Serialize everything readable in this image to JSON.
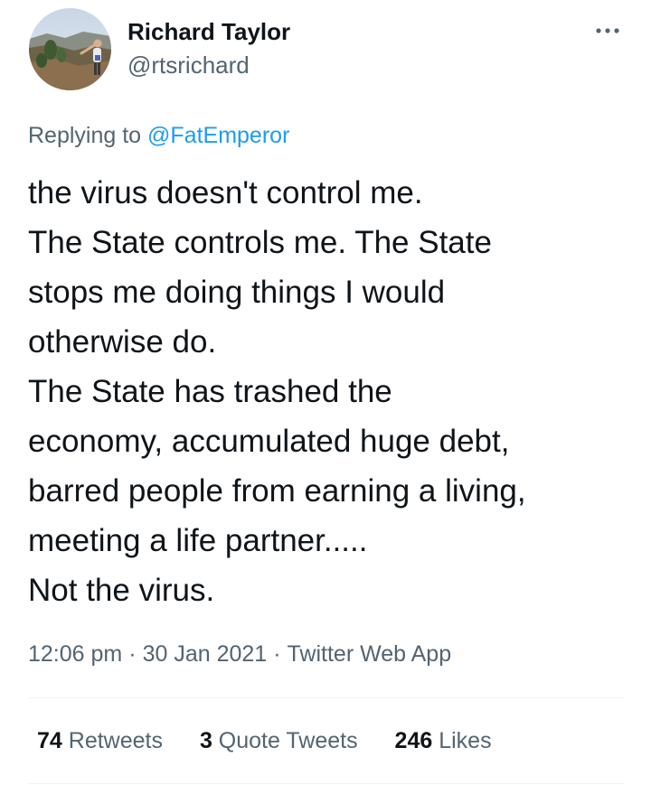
{
  "author": {
    "display_name": "Richard Taylor",
    "handle": "@rtsrichard"
  },
  "icons": {
    "more": "more-horizontal-icon",
    "avatar": "profile-photo"
  },
  "reply": {
    "prefix": "Replying to",
    "handle": "@FatEmperor"
  },
  "tweet": {
    "lines": [
      "the virus doesn't control me.",
      "The State controls me. The State",
      "stops me doing things I would",
      "otherwise do.",
      "The State has trashed the",
      "economy, accumulated huge debt,",
      "barred people from earning a living,",
      "meeting a life partner.....",
      "Not the virus."
    ]
  },
  "meta": {
    "time": "12:06 pm",
    "separator": "·",
    "date": "30 Jan 2021",
    "source": "Twitter Web App"
  },
  "stats": {
    "retweets": {
      "count": "74",
      "label": "Retweets"
    },
    "quotes": {
      "count": "3",
      "label": "Quote Tweets"
    },
    "likes": {
      "count": "246",
      "label": "Likes"
    }
  },
  "colors": {
    "text": "#0f1419",
    "secondary": "#536471",
    "link": "#1d9bf0",
    "divider": "#eff3f4"
  }
}
